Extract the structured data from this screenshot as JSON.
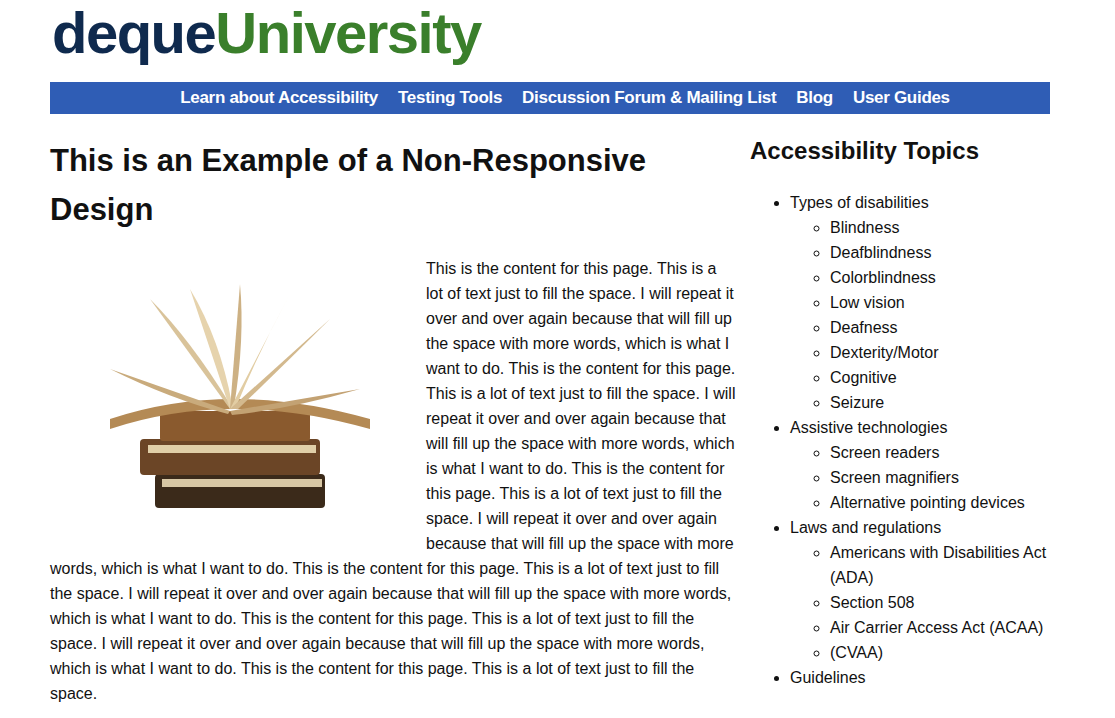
{
  "logo": {
    "first": "deque",
    "second": "University"
  },
  "nav": [
    {
      "label": "Learn about Accessibility"
    },
    {
      "label": "Testing Tools"
    },
    {
      "label": "Discussion Forum & Mailing List"
    },
    {
      "label": "Blog"
    },
    {
      "label": "User Guides"
    }
  ],
  "heading": "This is an Example of a Non-Responsive Design",
  "paragraph": "This is the content for this page. This is a lot of text just to fill the space. I will repeat it over and over again because that will fill up the space with more words, which is what I want to do. This is the content for this page. This is a lot of text just to fill the space. I will repeat it over and over again because that will fill up the space with more words, which is what I want to do. This is the content for this page. This is a lot of text just to fill the space. I will repeat it over and over again because that will fill up the space with more words, which is what I want to do. This is the content for this page. This is a lot of text just to fill the space. I will repeat it over and over again because that will fill up the space with more words, which is what I want to do. This is the content for this page. This is a lot of text just to fill the space. I will repeat it over and over again because that will fill up the space with more words, which is what I want to do. This is the content for this page. This is a lot of text just to fill the space.",
  "sidebar": {
    "title": "Accessibility Topics",
    "topics": [
      {
        "label": "Types of disabilities",
        "children": [
          "Blindness",
          "Deafblindness",
          "Colorblindness",
          "Low vision",
          "Deafness",
          "Dexterity/Motor",
          "Cognitive",
          "Seizure"
        ]
      },
      {
        "label": "Assistive technologies",
        "children": [
          "Screen readers",
          "Screen magnifiers",
          "Alternative pointing devices"
        ]
      },
      {
        "label": "Laws and regulations",
        "children": [
          "Americans with Disabilities Act (ADA)",
          "Section 508",
          "Air Carrier Access Act (ACAA)",
          "(CVAA)"
        ]
      },
      {
        "label": "Guidelines",
        "children": []
      }
    ]
  }
}
